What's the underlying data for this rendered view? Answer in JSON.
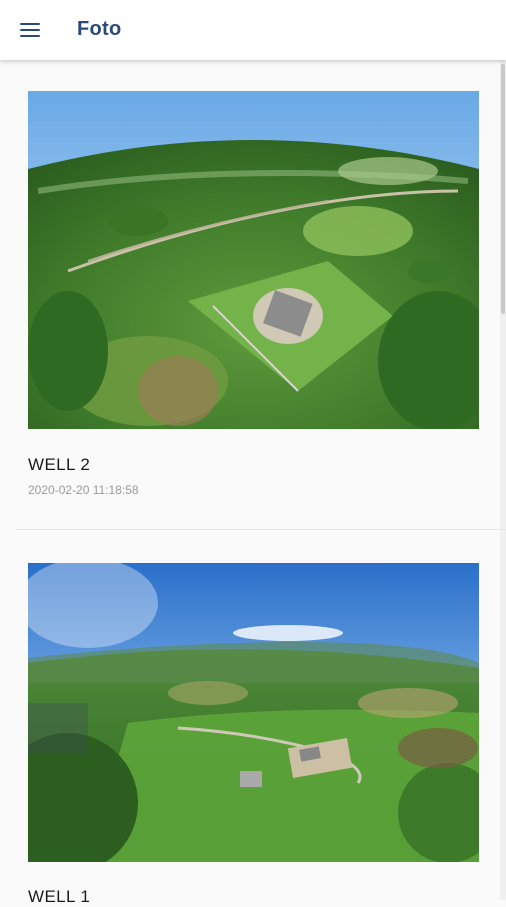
{
  "app_bar": {
    "title": "Foto",
    "menu_icon": "menu-icon"
  },
  "photos": [
    {
      "title": "WELL 2",
      "date": "2020-02-20 11:18:58"
    },
    {
      "title": "WELL 1",
      "date": ""
    }
  ],
  "colors": {
    "accent": "#2c4a78",
    "background": "#fafafa",
    "date_text": "#9a9a9a"
  }
}
